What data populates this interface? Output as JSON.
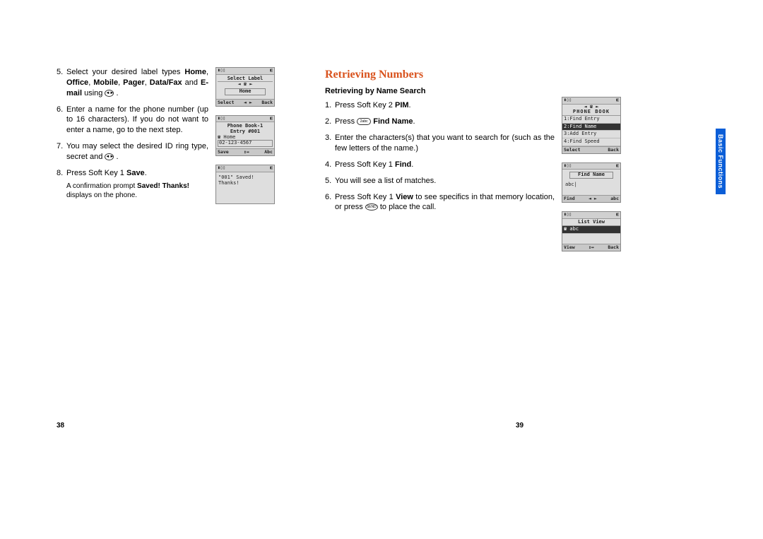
{
  "left": {
    "step5": {
      "num": "5.",
      "text_a": "Select your desired label types ",
      "bold1": "Home",
      "sep1": ", ",
      "bold2": "Office",
      "sep2": ", ",
      "bold3": "Mobile",
      "sep3": ", ",
      "bold4": "Pager",
      "sep4": ", ",
      "bold5": "Data/Fax",
      "mid": " and ",
      "bold6": "E-mail",
      "text_b": " using ",
      "icon": "◄►",
      "end": " ."
    },
    "step6": {
      "num": "6.",
      "text": "Enter a name for the phone number (up to 16 characters). If you do not want to enter a name, go to the next step."
    },
    "step7": {
      "num": "7.",
      "text_a": "You may select the desired ID ring type, secret and ",
      "icon": "◄►",
      "end": " ."
    },
    "step8": {
      "num": "8.",
      "text_a": "Press Soft Key 1 ",
      "bold": "Save",
      "end": "."
    },
    "note": {
      "a": "A confirmation prompt ",
      "bold": "Saved! Thanks!",
      "b": " displays on the phone."
    },
    "screens": {
      "s1": {
        "sig": "▮▯▯",
        "bat": "◧",
        "line1": "Select Label",
        "arrows": "◄ ☎ ►",
        "line2": "Home",
        "sk_l": "Select",
        "sk_m": "◄ ►",
        "sk_r": "Back"
      },
      "s2": {
        "sig": "▮▯▯",
        "bat": "◧",
        "line1": "Phone Book-1",
        "line2": "Entry #001",
        "line3": "☎ Home",
        "line4": "02-123-4567",
        "sk_l": "Save",
        "sk_m": "↕↔",
        "sk_r": "Abc"
      },
      "s3": {
        "sig": "▮▯▯",
        "bat": "◧",
        "line1": "\"001\" Saved!",
        "line2": "Thanks!"
      }
    }
  },
  "right": {
    "title": "Retrieving Numbers",
    "subtitle": "Retrieving by Name Search",
    "step1": {
      "num": "1.",
      "a": "Press Soft Key 2 ",
      "b": "PIM",
      "c": "."
    },
    "step2": {
      "num": "2.",
      "a": "Press ",
      "icon": "2abc",
      "sp": " ",
      "b": "Find Name",
      "c": "."
    },
    "step3": {
      "num": "3.",
      "text": "Enter the characters(s) that you want to search for (such as the few letters of the name.)"
    },
    "step4": {
      "num": "4.",
      "a": "Press Soft Key 1 ",
      "b": "Find",
      "c": "."
    },
    "step5": {
      "num": "5.",
      "text": "You will see a list of matches."
    },
    "step6": {
      "num": "6.",
      "a": "Press Soft Key 1 ",
      "b": "View",
      "c": " to see specifics in that memory location, or press ",
      "icon": "SEND",
      "d": " to place the call."
    },
    "screens": {
      "s1": {
        "sig": "▮▯▯",
        "bat": "◧",
        "row0": "◄  ☎  ►",
        "title": "PHONE BOOK",
        "row1": "1:Find Entry",
        "row2": "2:Find Name",
        "row3": "3:Add Entry",
        "row4": "4:Find Speed",
        "sk_l": "Select",
        "sk_r": "Back"
      },
      "s2": {
        "sig": "▮▯▯",
        "bat": "◧",
        "title": "Find Name",
        "input": "abc|",
        "sk_l": "Find",
        "sk_m": "◄ ►",
        "sk_r": "abc"
      },
      "s3": {
        "sig": "▮▯▯",
        "bat": "◧",
        "title": "List View",
        "row1": "☎ abc",
        "sk_l": "View",
        "sk_m": "↕↔",
        "sk_r": "Back"
      }
    }
  },
  "pageLeft": "38",
  "pageRight": "39",
  "sideTab": "Basic Functions"
}
